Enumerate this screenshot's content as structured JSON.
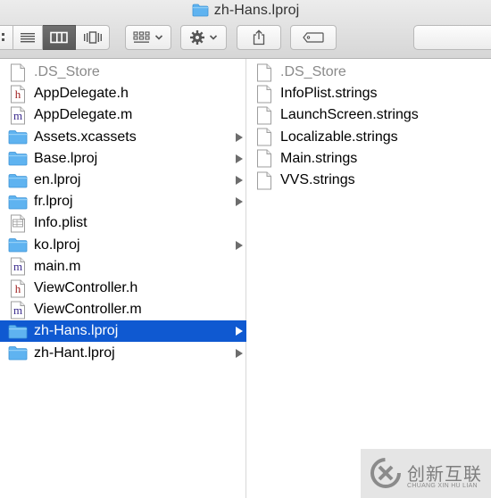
{
  "window": {
    "title": "zh-Hans.lproj"
  },
  "toolbar": {
    "view_modes": [
      {
        "name": "icon-view",
        "active": false
      },
      {
        "name": "list-view",
        "active": false
      },
      {
        "name": "column-view",
        "active": true
      },
      {
        "name": "cover-flow-view",
        "active": false
      }
    ],
    "arrange_icon": "grid-arrange-icon",
    "action_icon": "gear-icon",
    "share_icon": "share-icon",
    "tag_icon": "tag-icon",
    "search_placeholder": ""
  },
  "columns": [
    {
      "items": [
        {
          "name": ".DS_Store",
          "icon": "blank-doc",
          "dim": true,
          "folder": false,
          "selected": false
        },
        {
          "name": "AppDelegate.h",
          "icon": "h-file",
          "folder": false,
          "selected": false
        },
        {
          "name": "AppDelegate.m",
          "icon": "m-file",
          "folder": false,
          "selected": false
        },
        {
          "name": "Assets.xcassets",
          "icon": "folder",
          "folder": true,
          "selected": false
        },
        {
          "name": "Base.lproj",
          "icon": "folder",
          "folder": true,
          "selected": false
        },
        {
          "name": "en.lproj",
          "icon": "folder",
          "folder": true,
          "selected": false
        },
        {
          "name": "fr.lproj",
          "icon": "folder",
          "folder": true,
          "selected": false
        },
        {
          "name": "Info.plist",
          "icon": "plist",
          "folder": false,
          "selected": false
        },
        {
          "name": "ko.lproj",
          "icon": "folder",
          "folder": true,
          "selected": false
        },
        {
          "name": "main.m",
          "icon": "m-file",
          "folder": false,
          "selected": false
        },
        {
          "name": "ViewController.h",
          "icon": "h-file",
          "folder": false,
          "selected": false
        },
        {
          "name": "ViewController.m",
          "icon": "m-file",
          "folder": false,
          "selected": false
        },
        {
          "name": "zh-Hans.lproj",
          "icon": "folder",
          "folder": true,
          "selected": true
        },
        {
          "name": "zh-Hant.lproj",
          "icon": "folder",
          "folder": true,
          "selected": false
        }
      ]
    },
    {
      "items": [
        {
          "name": ".DS_Store",
          "icon": "blank-doc",
          "dim": true,
          "folder": false,
          "selected": false
        },
        {
          "name": "InfoPlist.strings",
          "icon": "blank-doc",
          "folder": false,
          "selected": false
        },
        {
          "name": "LaunchScreen.strings",
          "icon": "blank-doc",
          "folder": false,
          "selected": false
        },
        {
          "name": "Localizable.strings",
          "icon": "blank-doc",
          "folder": false,
          "selected": false
        },
        {
          "name": "Main.strings",
          "icon": "blank-doc",
          "folder": false,
          "selected": false
        },
        {
          "name": "VVS.strings",
          "icon": "blank-doc",
          "folder": false,
          "selected": false
        }
      ]
    }
  ],
  "watermark": {
    "text": "创新互联",
    "subtext": "CHUANG XIN HU LIAN"
  },
  "colors": {
    "selection": "#0f59d1",
    "folder": "#5fb3f0",
    "h_letter": "#a02020",
    "m_letter": "#3a2a8c"
  }
}
